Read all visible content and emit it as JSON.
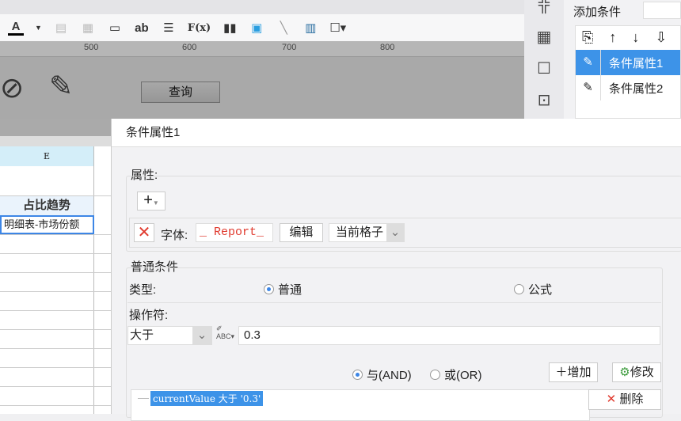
{
  "toolbar": {
    "icons": [
      "font-color",
      "merge-cells",
      "table-grid",
      "field",
      "text-ab",
      "align",
      "formula",
      "bar-chart",
      "image",
      "slash",
      "doc",
      "border"
    ],
    "labels": {
      "font": "A",
      "ab": "ab",
      "formula": "F(x)"
    }
  },
  "ruler": {
    "ticks": [
      "500",
      "600",
      "700",
      "800"
    ]
  },
  "canvas": {
    "query_button": "查询"
  },
  "right_panel": {
    "title": "添加条件",
    "items": [
      {
        "label": "条件属性1",
        "selected": true
      },
      {
        "label": "条件属性2",
        "selected": false
      }
    ]
  },
  "sheet": {
    "column": "E",
    "header_cell": "占比趋势",
    "selected_cell": "明细表-市场份额"
  },
  "dialog": {
    "title": "条件属性1",
    "attributes_label": "属性:",
    "add_label": "+",
    "font_label": "字体:",
    "font_preview": "_ Report_",
    "edit_button": "编辑",
    "scope_value": "当前格子",
    "normal_condition_label": "普通条件",
    "type_label": "类型:",
    "type_options": [
      "普通",
      "公式"
    ],
    "operator_label": "操作符:",
    "operator_value": "大于",
    "value": "0.3",
    "and_label": "与(AND)",
    "or_label": "或(OR)",
    "add_button": "增加",
    "modify_button": "修改",
    "delete_button": "删除",
    "condition_entry": "currentValue 大于 '0.3'"
  },
  "colors": {
    "accent": "#3d93e8",
    "header_blue": "#d4eef9",
    "red": "#e03a2e"
  }
}
